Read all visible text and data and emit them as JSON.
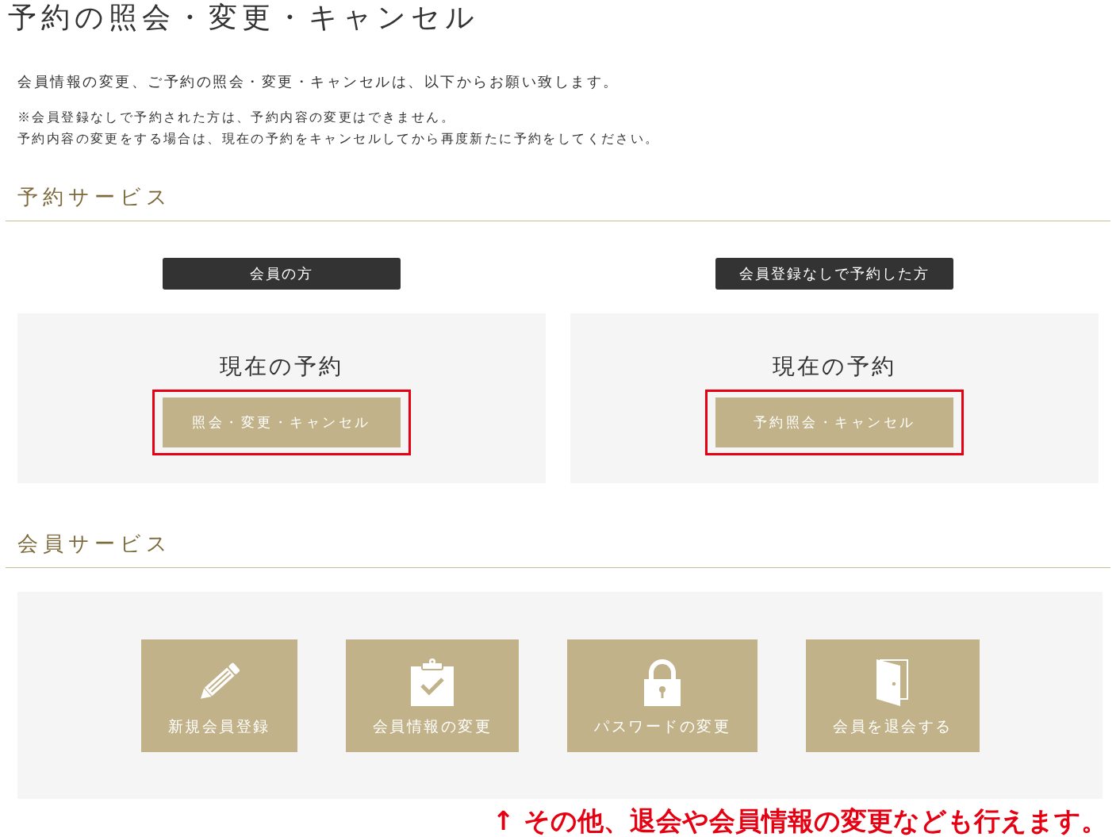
{
  "page_title": "予約の照会・変更・キャンセル",
  "intro": "会員情報の変更、ご予約の照会・変更・キャンセルは、以下からお願い致します。",
  "notes": [
    "※会員登録なしで予約された方は、予約内容の変更はできません。",
    "予約内容の変更をする場合は、現在の予約をキャンセルしてから再度新たに予約をしてください。"
  ],
  "reservation_service": {
    "heading": "予約サービス",
    "columns": [
      {
        "label": "会員の方",
        "card_title": "現在の予約",
        "button": {
          "label": "照会・変更・キャンセル",
          "highlighted": true
        }
      },
      {
        "label": "会員登録なしで予約した方",
        "card_title": "現在の予約",
        "button": {
          "label": "予約照会・キャンセル",
          "highlighted": true
        }
      }
    ]
  },
  "member_service": {
    "heading": "会員サービス",
    "tiles": [
      {
        "label": "新規会員登録"
      },
      {
        "label": "会員情報の変更"
      },
      {
        "label": "パスワードの変更"
      },
      {
        "label": "会員を退会する"
      }
    ]
  },
  "annotation": {
    "text": "↑ その他、退会や会員情報の変更なども行えます。"
  }
}
